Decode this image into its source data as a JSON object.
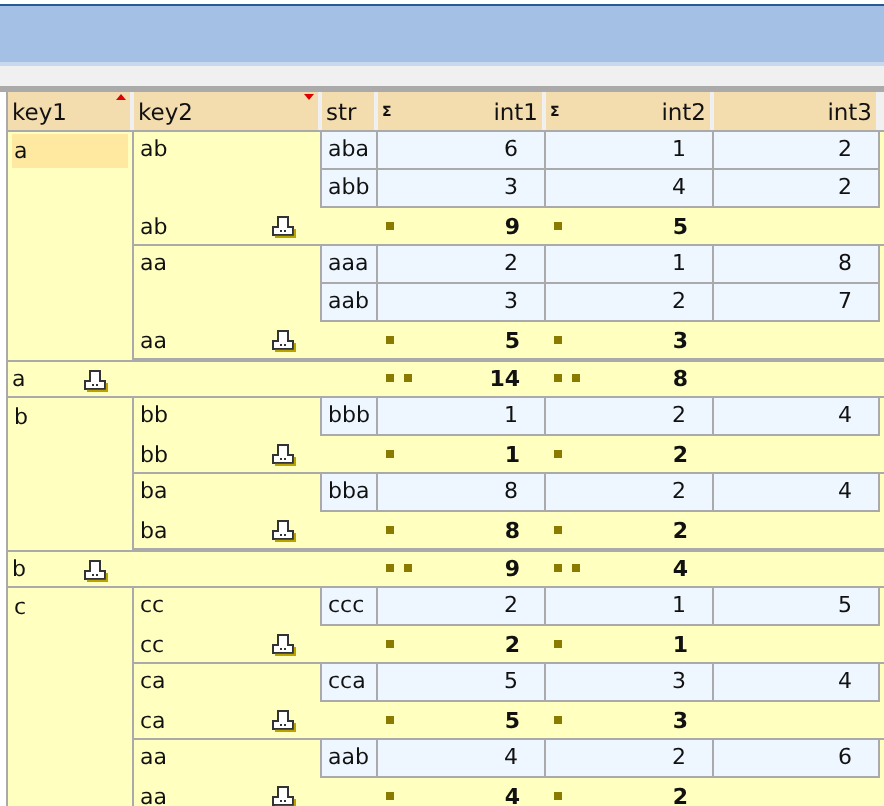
{
  "columns": [
    {
      "label": "key1",
      "sorted": true,
      "descending": false
    },
    {
      "label": "key2",
      "sorted": true,
      "descending": true
    },
    {
      "label": "str",
      "sorted": false
    },
    {
      "label": "int1",
      "sorted": false,
      "sum": "Σ"
    },
    {
      "label": "int2",
      "sorted": false,
      "sum": "Σ"
    },
    {
      "label": "int3",
      "sorted": false
    }
  ],
  "groups": [
    {
      "key": "a",
      "selected": true,
      "subgroups": [
        {
          "key": "ab",
          "rows": [
            [
              "aba",
              "6",
              "1",
              "2"
            ],
            [
              "abb",
              "3",
              "4",
              "2"
            ]
          ],
          "total_label": "ab",
          "sums": [
            "9",
            "5"
          ]
        },
        {
          "key": "aa",
          "rows": [
            [
              "aaa",
              "2",
              "1",
              "8"
            ],
            [
              "aab",
              "3",
              "2",
              "7"
            ]
          ],
          "total_label": "aa",
          "sums": [
            "5",
            "3"
          ]
        }
      ],
      "total_label": "a",
      "sums": [
        "14",
        "8"
      ]
    },
    {
      "key": "b",
      "selected": false,
      "subgroups": [
        {
          "key": "bb",
          "rows": [
            [
              "bbb",
              "1",
              "2",
              "4"
            ]
          ],
          "total_label": "bb",
          "sums": [
            "1",
            "2"
          ]
        },
        {
          "key": "ba",
          "rows": [
            [
              "bba",
              "8",
              "2",
              "4"
            ]
          ],
          "total_label": "ba",
          "sums": [
            "8",
            "2"
          ]
        }
      ],
      "total_label": "b",
      "sums": [
        "9",
        "4"
      ]
    },
    {
      "key": "c",
      "selected": false,
      "subgroups": [
        {
          "key": "cc",
          "rows": [
            [
              "ccc",
              "2",
              "1",
              "5"
            ]
          ],
          "total_label": "cc",
          "sums": [
            "2",
            "1"
          ]
        },
        {
          "key": "ca",
          "rows": [
            [
              "cca",
              "5",
              "3",
              "4"
            ]
          ],
          "total_label": "ca",
          "sums": [
            "5",
            "3"
          ]
        },
        {
          "key": "aa",
          "rows": [
            [
              "aab",
              "4",
              "2",
              "6"
            ]
          ],
          "total_label": "aa",
          "sums": [
            "4",
            "2"
          ]
        }
      ]
    }
  ]
}
